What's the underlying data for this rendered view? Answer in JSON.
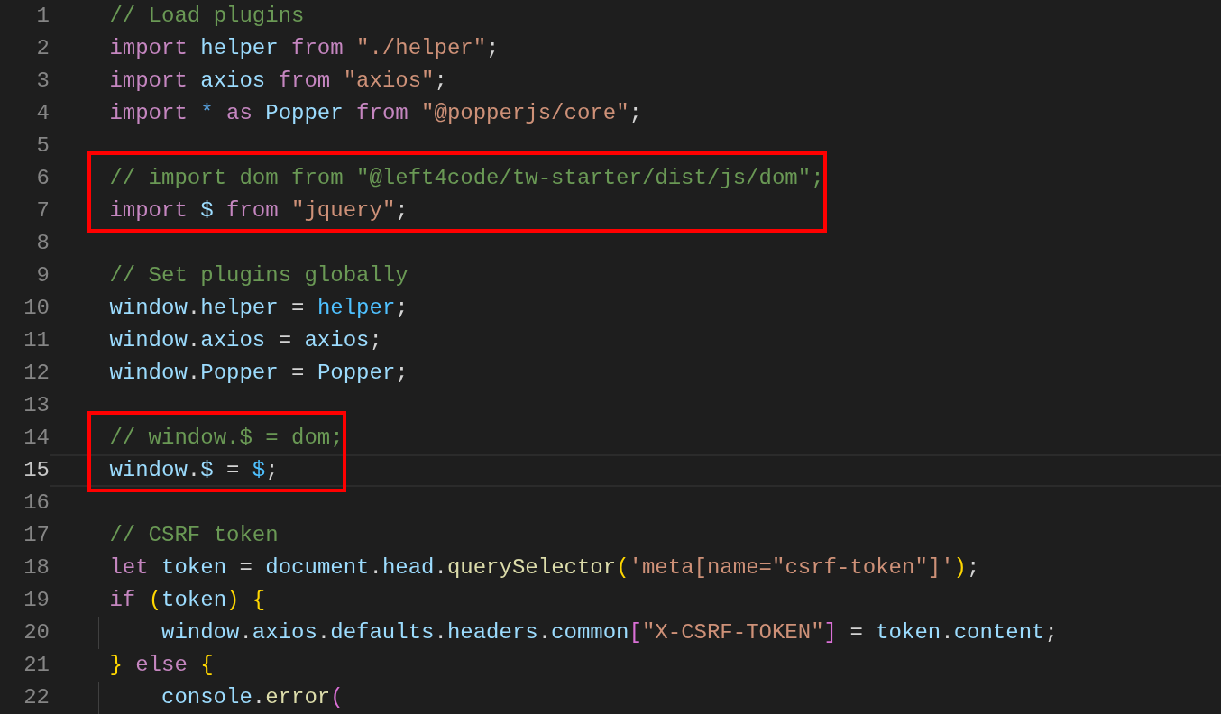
{
  "editor": {
    "blocks": [
      {
        "boxed": false,
        "lines": [
          {
            "number": "1",
            "current": false,
            "indented": false,
            "tokens": [
              {
                "text": "// Load plugins",
                "kind": "comment"
              }
            ]
          },
          {
            "number": "2",
            "current": false,
            "indented": false,
            "tokens": [
              {
                "text": "import",
                "kind": "keyword"
              },
              {
                "text": " helper ",
                "kind": "variable"
              },
              {
                "text": "from",
                "kind": "keyword"
              },
              {
                "text": " \"./helper\"",
                "kind": "string"
              },
              {
                "text": ";",
                "kind": "punct"
              }
            ]
          },
          {
            "number": "3",
            "current": false,
            "indented": false,
            "tokens": [
              {
                "text": "import",
                "kind": "keyword"
              },
              {
                "text": " axios ",
                "kind": "variable"
              },
              {
                "text": "from",
                "kind": "keyword"
              },
              {
                "text": " \"axios\"",
                "kind": "string"
              },
              {
                "text": ";",
                "kind": "punct"
              }
            ]
          },
          {
            "number": "4",
            "current": false,
            "indented": false,
            "tokens": [
              {
                "text": "import",
                "kind": "keyword"
              },
              {
                "text": " * ",
                "kind": "operator"
              },
              {
                "text": "as",
                "kind": "keyword"
              },
              {
                "text": " Popper ",
                "kind": "variable"
              },
              {
                "text": "from",
                "kind": "keyword"
              },
              {
                "text": " \"@popperjs/core\"",
                "kind": "string"
              },
              {
                "text": ";",
                "kind": "punct"
              }
            ]
          },
          {
            "number": "5",
            "current": false,
            "indented": false
          }
        ]
      },
      {
        "boxed": true,
        "lines": [
          {
            "number": "6",
            "current": false,
            "indented": false,
            "tokens": [
              {
                "text": "// import dom from \"@left4code/tw-starter/dist/js/dom\";",
                "kind": "comment"
              }
            ]
          },
          {
            "number": "7",
            "current": false,
            "indented": false,
            "tokens": [
              {
                "text": "import",
                "kind": "keyword"
              },
              {
                "text": " $ ",
                "kind": "variable"
              },
              {
                "text": "from",
                "kind": "keyword"
              },
              {
                "text": " \"jquery\"",
                "kind": "string"
              },
              {
                "text": ";",
                "kind": "punct"
              }
            ]
          }
        ]
      },
      {
        "boxed": false,
        "lines": [
          {
            "number": "8",
            "current": false,
            "indented": false
          },
          {
            "number": "9",
            "current": false,
            "indented": false,
            "tokens": [
              {
                "text": "// Set plugins globally",
                "kind": "comment"
              }
            ]
          },
          {
            "number": "10",
            "current": false,
            "indented": false,
            "tokens": [
              {
                "text": "window",
                "kind": "variable"
              },
              {
                "text": ".",
                "kind": "punct"
              },
              {
                "text": "helper",
                "kind": "variable"
              },
              {
                "text": " = ",
                "kind": "punct"
              },
              {
                "text": "helper",
                "kind": "constant"
              },
              {
                "text": ";",
                "kind": "punct"
              }
            ]
          },
          {
            "number": "11",
            "current": false,
            "indented": false,
            "tokens": [
              {
                "text": "window",
                "kind": "variable"
              },
              {
                "text": ".",
                "kind": "punct"
              },
              {
                "text": "axios",
                "kind": "variable"
              },
              {
                "text": " = ",
                "kind": "punct"
              },
              {
                "text": "axios",
                "kind": "variable"
              },
              {
                "text": ";",
                "kind": "punct"
              }
            ]
          },
          {
            "number": "12",
            "current": false,
            "indented": false,
            "tokens": [
              {
                "text": "window",
                "kind": "variable"
              },
              {
                "text": ".",
                "kind": "punct"
              },
              {
                "text": "Popper",
                "kind": "variable"
              },
              {
                "text": " = ",
                "kind": "punct"
              },
              {
                "text": "Popper",
                "kind": "variable"
              },
              {
                "text": ";",
                "kind": "punct"
              }
            ]
          },
          {
            "number": "13",
            "current": false,
            "indented": false
          }
        ]
      },
      {
        "boxed": true,
        "lines": [
          {
            "number": "14",
            "current": false,
            "indented": false,
            "tokens": [
              {
                "text": "// window.$ = dom;",
                "kind": "comment"
              }
            ]
          },
          {
            "number": "15",
            "current": true,
            "indented": false,
            "tokens": [
              {
                "text": "window",
                "kind": "variable"
              },
              {
                "text": ".",
                "kind": "punct"
              },
              {
                "text": "$",
                "kind": "variable"
              },
              {
                "text": " = ",
                "kind": "punct"
              },
              {
                "text": "$",
                "kind": "constant"
              },
              {
                "text": ";",
                "kind": "punct"
              }
            ]
          }
        ]
      },
      {
        "boxed": false,
        "lines": [
          {
            "number": "16",
            "current": false,
            "indented": false
          },
          {
            "number": "17",
            "current": false,
            "indented": false,
            "tokens": [
              {
                "text": "// CSRF token",
                "kind": "comment"
              }
            ]
          },
          {
            "number": "18",
            "current": false,
            "indented": false,
            "tokens": [
              {
                "text": "let",
                "kind": "keyword"
              },
              {
                "text": " token ",
                "kind": "variable"
              },
              {
                "text": "= ",
                "kind": "punct"
              },
              {
                "text": "document",
                "kind": "variable"
              },
              {
                "text": ".",
                "kind": "punct"
              },
              {
                "text": "head",
                "kind": "variable"
              },
              {
                "text": ".",
                "kind": "punct"
              },
              {
                "text": "querySelector",
                "kind": "function"
              },
              {
                "text": "(",
                "kind": "bracket1"
              },
              {
                "text": "'meta[name=\"csrf-token\"]'",
                "kind": "string"
              },
              {
                "text": ")",
                "kind": "bracket1"
              },
              {
                "text": ";",
                "kind": "punct"
              }
            ]
          },
          {
            "number": "19",
            "current": false,
            "indented": false,
            "tokens": [
              {
                "text": "if ",
                "kind": "keyword"
              },
              {
                "text": "(",
                "kind": "bracket1"
              },
              {
                "text": "token",
                "kind": "variable"
              },
              {
                "text": ") {",
                "kind": "bracket1"
              }
            ]
          },
          {
            "number": "20",
            "current": false,
            "indented": true,
            "tokens": [
              {
                "text": "window",
                "kind": "variable"
              },
              {
                "text": ".",
                "kind": "punct"
              },
              {
                "text": "axios",
                "kind": "variable"
              },
              {
                "text": ".",
                "kind": "punct"
              },
              {
                "text": "defaults",
                "kind": "variable"
              },
              {
                "text": ".",
                "kind": "punct"
              },
              {
                "text": "headers",
                "kind": "variable"
              },
              {
                "text": ".",
                "kind": "punct"
              },
              {
                "text": "common",
                "kind": "variable"
              },
              {
                "text": "[",
                "kind": "bracket2"
              },
              {
                "text": "\"X-CSRF-TOKEN\"",
                "kind": "string"
              },
              {
                "text": "]",
                "kind": "bracket2"
              },
              {
                "text": " = ",
                "kind": "punct"
              },
              {
                "text": "token",
                "kind": "variable"
              },
              {
                "text": ".",
                "kind": "punct"
              },
              {
                "text": "content",
                "kind": "variable"
              },
              {
                "text": ";",
                "kind": "punct"
              }
            ]
          },
          {
            "number": "21",
            "current": false,
            "indented": false,
            "tokens": [
              {
                "text": "} ",
                "kind": "bracket1"
              },
              {
                "text": "else ",
                "kind": "keyword"
              },
              {
                "text": "{",
                "kind": "bracket1"
              }
            ]
          },
          {
            "number": "22",
            "current": false,
            "indented": true,
            "tokens": [
              {
                "text": "console",
                "kind": "variable"
              },
              {
                "text": ".",
                "kind": "punct"
              },
              {
                "text": "error",
                "kind": "function"
              },
              {
                "text": "(",
                "kind": "bracket2"
              }
            ]
          }
        ]
      }
    ]
  }
}
